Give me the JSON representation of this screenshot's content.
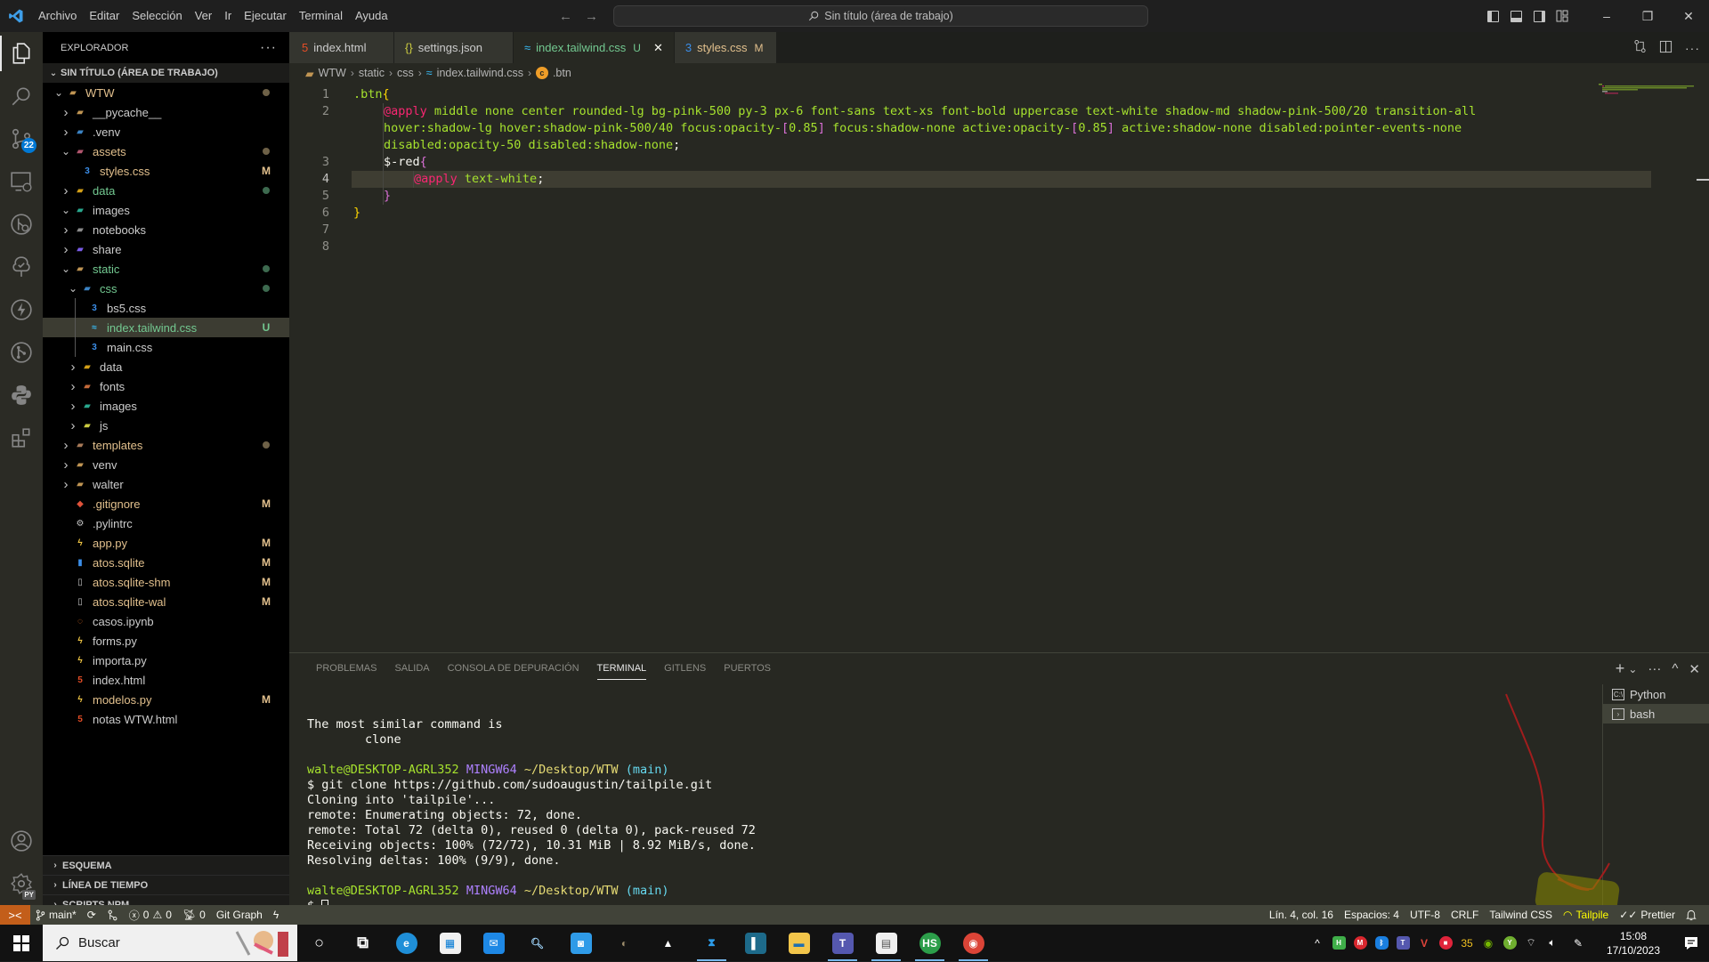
{
  "titlebar": {
    "menu": [
      "Archivo",
      "Editar",
      "Selección",
      "Ver",
      "Ir",
      "Ejecutar",
      "Terminal",
      "Ayuda"
    ],
    "command_center": "Sin título (área de trabajo)",
    "nav_back": "←",
    "nav_forward": "→",
    "layout_icons": [
      "toggle-primary-sidebar-icon",
      "toggle-panel-icon",
      "toggle-secondary-sidebar-icon",
      "customize-layout-icon"
    ],
    "window_controls": {
      "minimize": "–",
      "restore": "❐",
      "close": "✕"
    }
  },
  "activitybar": {
    "items": [
      {
        "name": "explorer",
        "active": true
      },
      {
        "name": "search"
      },
      {
        "name": "source-control",
        "badge": "22"
      },
      {
        "name": "remote-explorer"
      },
      {
        "name": "gitlens"
      },
      {
        "name": "testing"
      },
      {
        "name": "thunder-client"
      },
      {
        "name": "git-graph"
      },
      {
        "name": "python"
      },
      {
        "name": "extensions"
      }
    ],
    "bottom": [
      {
        "name": "accounts"
      },
      {
        "name": "manage",
        "badge": "PY"
      }
    ]
  },
  "sidebar": {
    "title": "EXPLORADOR",
    "more": "···",
    "workspace": "SIN TÍTULO (ÁREA DE TRABAJO)",
    "tree": [
      {
        "label": "WTW",
        "depth": 0,
        "type": "folder",
        "open": true,
        "color": "modified",
        "deco": "dot-modified",
        "icon": "root"
      },
      {
        "label": "__pycache__",
        "depth": 1,
        "type": "folder",
        "open": false,
        "color": "default",
        "icon": "folder"
      },
      {
        "label": ".venv",
        "depth": 1,
        "type": "folder",
        "open": false,
        "color": "default",
        "icon": "python-folder"
      },
      {
        "label": "assets",
        "depth": 1,
        "type": "folder",
        "open": true,
        "color": "modified",
        "deco": "dot-modified",
        "icon": "assets"
      },
      {
        "label": "styles.css",
        "depth": 2,
        "type": "file",
        "color": "modified",
        "deco": "M",
        "icon": "css"
      },
      {
        "label": "data",
        "depth": 1,
        "type": "folder",
        "open": false,
        "color": "untracked",
        "deco": "dot-untracked",
        "icon": "data"
      },
      {
        "label": "images",
        "depth": 1,
        "type": "folder",
        "open": true,
        "color": "default",
        "icon": "images"
      },
      {
        "label": "notebooks",
        "depth": 1,
        "type": "folder",
        "open": false,
        "color": "default",
        "icon": "notebooks"
      },
      {
        "label": "share",
        "depth": 1,
        "type": "folder",
        "open": false,
        "color": "default",
        "icon": "share"
      },
      {
        "label": "static",
        "depth": 1,
        "type": "folder",
        "open": true,
        "color": "untracked",
        "deco": "dot-untracked",
        "icon": "static"
      },
      {
        "label": "css",
        "depth": 2,
        "type": "folder",
        "open": true,
        "color": "untracked",
        "deco": "dot-untracked",
        "icon": "css-folder"
      },
      {
        "label": "bs5.css",
        "depth": 3,
        "type": "file",
        "color": "default",
        "icon": "css"
      },
      {
        "label": "index.tailwind.css",
        "depth": 3,
        "type": "file",
        "color": "untracked",
        "deco": "U",
        "icon": "tailwind",
        "selected": true
      },
      {
        "label": "main.css",
        "depth": 3,
        "type": "file",
        "color": "default",
        "icon": "css"
      },
      {
        "label": "data",
        "depth": 2,
        "type": "folder",
        "open": false,
        "color": "default",
        "icon": "data"
      },
      {
        "label": "fonts",
        "depth": 2,
        "type": "folder",
        "open": false,
        "color": "default",
        "icon": "fonts"
      },
      {
        "label": "images",
        "depth": 2,
        "type": "folder",
        "open": false,
        "color": "default",
        "icon": "images"
      },
      {
        "label": "js",
        "depth": 2,
        "type": "folder",
        "open": false,
        "color": "default",
        "icon": "js"
      },
      {
        "label": "templates",
        "depth": 1,
        "type": "folder",
        "open": false,
        "color": "modified",
        "deco": "dot-modified",
        "icon": "templates"
      },
      {
        "label": "venv",
        "depth": 1,
        "type": "folder",
        "open": false,
        "color": "default",
        "icon": "folder"
      },
      {
        "label": "walter",
        "depth": 1,
        "type": "folder",
        "open": false,
        "color": "default",
        "icon": "folder"
      },
      {
        "label": ".gitignore",
        "depth": 1,
        "type": "file",
        "color": "modified",
        "deco": "M",
        "icon": "git"
      },
      {
        "label": ".pylintrc",
        "depth": 1,
        "type": "file",
        "color": "default",
        "icon": "gear"
      },
      {
        "label": "app.py",
        "depth": 1,
        "type": "file",
        "color": "modified",
        "deco": "M",
        "icon": "python"
      },
      {
        "label": "atos.sqlite",
        "depth": 1,
        "type": "file",
        "color": "modified",
        "deco": "M",
        "icon": "sqlite"
      },
      {
        "label": "atos.sqlite-shm",
        "depth": 1,
        "type": "file",
        "color": "modified",
        "deco": "M",
        "icon": "file"
      },
      {
        "label": "atos.sqlite-wal",
        "depth": 1,
        "type": "file",
        "color": "modified",
        "deco": "M",
        "icon": "file"
      },
      {
        "label": "casos.ipynb",
        "depth": 1,
        "type": "file",
        "color": "default",
        "icon": "jupyter"
      },
      {
        "label": "forms.py",
        "depth": 1,
        "type": "file",
        "color": "default",
        "icon": "python"
      },
      {
        "label": "importa.py",
        "depth": 1,
        "type": "file",
        "color": "default",
        "icon": "python"
      },
      {
        "label": "index.html",
        "depth": 1,
        "type": "file",
        "color": "default",
        "icon": "html"
      },
      {
        "label": "modelos.py",
        "depth": 1,
        "type": "file",
        "color": "modified",
        "deco": "M",
        "icon": "python"
      },
      {
        "label": "notas WTW.html",
        "depth": 1,
        "type": "file",
        "color": "default",
        "icon": "html"
      }
    ],
    "sections": [
      "ESQUEMA",
      "LÍNEA DE TIEMPO",
      "SCRIPTS NPM"
    ]
  },
  "editor": {
    "tabs": [
      {
        "label": "index.html",
        "icon": "html",
        "color": "default"
      },
      {
        "label": "settings.json",
        "icon": "json",
        "color": "default"
      },
      {
        "label": "index.tailwind.css",
        "icon": "tailwind",
        "color": "untracked",
        "status": "U",
        "active": true
      },
      {
        "label": "styles.css",
        "icon": "css",
        "color": "modified",
        "status": "M"
      }
    ],
    "breadcrumb": [
      "WTW",
      "static",
      "css",
      "index.tailwind.css",
      ".btn"
    ],
    "current_line": 4,
    "lines": [
      {
        "n": "1",
        "tokens": [
          [
            ".btn",
            "sel"
          ],
          [
            "{",
            "brace1"
          ]
        ]
      },
      {
        "n": "2",
        "indent": 1,
        "tokens": [
          [
            "@apply",
            "at"
          ],
          [
            " middle none center rounded-lg bg-pink-500 py-3 px-6 font-sans text-xs font-bold uppercase text-white shadow-md shadow-pink-500/20 transition-all",
            "val"
          ]
        ]
      },
      {
        "n": "",
        "indent": 1,
        "tokens": [
          [
            "hover:shadow-lg hover:shadow-pink-500/40 focus:opacity-",
            "val"
          ],
          [
            "[",
            "br"
          ],
          [
            "0.85",
            "num"
          ],
          [
            "]",
            "br"
          ],
          [
            " focus:shadow-none active:opacity-",
            "val"
          ],
          [
            "[",
            "br"
          ],
          [
            "0.85",
            "num"
          ],
          [
            "]",
            "br"
          ],
          [
            " active:shadow-none disabled:pointer-events-none",
            "val"
          ]
        ]
      },
      {
        "n": "",
        "indent": 1,
        "tokens": [
          [
            "disabled:opacity-50 disabled:shadow-none",
            "val"
          ],
          [
            ";",
            "punc"
          ]
        ]
      },
      {
        "n": "3",
        "indent": 1,
        "tokens": [
          [
            "$-red",
            "punc"
          ],
          [
            "{",
            "brace2"
          ]
        ]
      },
      {
        "n": "4",
        "indent": 2,
        "tokens": [
          [
            "@apply",
            "at"
          ],
          [
            " text-white",
            "val"
          ],
          [
            ";",
            "punc"
          ]
        ]
      },
      {
        "n": "5",
        "indent": 1,
        "tokens": [
          [
            "}",
            "brace2"
          ]
        ]
      },
      {
        "n": "6",
        "tokens": [
          [
            "}",
            "brace1"
          ]
        ]
      },
      {
        "n": "7",
        "tokens": []
      },
      {
        "n": "8",
        "tokens": []
      }
    ]
  },
  "panel": {
    "tabs": [
      "PROBLEMAS",
      "SALIDA",
      "CONSOLA DE DEPURACIÓN",
      "TERMINAL",
      "GITLENS",
      "PUERTOS"
    ],
    "active_tab": "TERMINAL",
    "terminal_lines": [
      {
        "text": ""
      },
      {
        "text": "The most similar command is"
      },
      {
        "text": "        clone"
      },
      {
        "text": ""
      },
      {
        "prompt": {
          "user": "walte@DESKTOP-AGRL352",
          "host": "MINGW64",
          "path": "~/Desktop/WTW",
          "branch": "(main)"
        }
      },
      {
        "text": "$ git clone https://github.com/sudoaugustin/tailpile.git"
      },
      {
        "text": "Cloning into 'tailpile'..."
      },
      {
        "text": "remote: Enumerating objects: 72, done."
      },
      {
        "text": "remote: Total 72 (delta 0), reused 0 (delta 0), pack-reused 72"
      },
      {
        "text": "Receiving objects: 100% (72/72), 10.31 MiB | 8.92 MiB/s, done."
      },
      {
        "text": "Resolving deltas: 100% (9/9), done."
      },
      {
        "text": ""
      },
      {
        "prompt": {
          "user": "walte@DESKTOP-AGRL352",
          "host": "MINGW64",
          "path": "~/Desktop/WTW",
          "branch": "(main)"
        }
      },
      {
        "text": "$ ",
        "cursor": true
      }
    ],
    "terminals": [
      {
        "label": "Python",
        "icon": "cmd"
      },
      {
        "label": "bash",
        "icon": "terminal",
        "active": true
      }
    ],
    "actions": [
      "+",
      "⌄",
      "···",
      "^",
      "✕"
    ]
  },
  "statusbar": {
    "left": {
      "remote": "><",
      "branch": "main*",
      "sync": "⟳",
      "errors": "0",
      "warnings": "0",
      "ports": "0",
      "git_graph": "Git Graph"
    },
    "right": {
      "position": "Lín. 4, col. 16",
      "spaces": "Espacios: 4",
      "encoding": "UTF-8",
      "eol": "CRLF",
      "language": "Tailwind CSS",
      "tailpile": "Tailpile",
      "prettier": "Prettier"
    }
  },
  "taskbar": {
    "search_placeholder": "Buscar",
    "apps": [
      "cortana",
      "task-view",
      "edge",
      "store",
      "mail",
      "search-app",
      "people",
      "gimp",
      "inkscape",
      "vscode",
      "bookstack",
      "file-explorer",
      "teams",
      "document",
      "hs-app",
      "chrome"
    ],
    "tray_number": "35",
    "time": "15:08",
    "date": "17/10/2023"
  },
  "colors": {
    "modified": "#e2c08d",
    "untracked": "#73c991",
    "accent": "#0078d4",
    "statusbar": "#414339",
    "remote": "#c35e1a",
    "highlight": "#ffff00",
    "annotation_arrow": "#a11d1d"
  }
}
